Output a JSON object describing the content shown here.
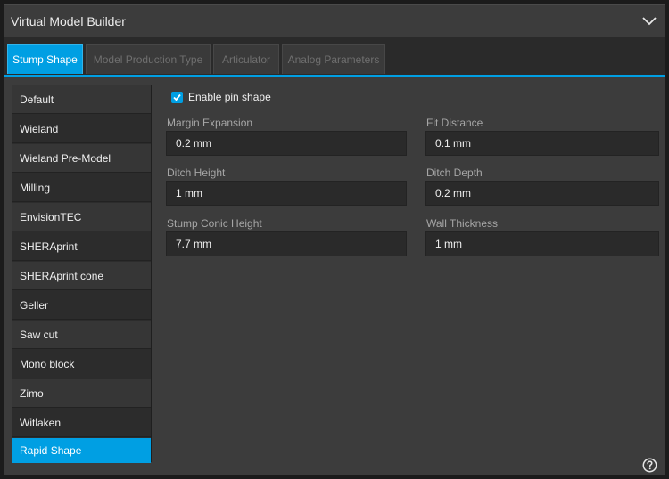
{
  "window": {
    "title": "Virtual Model Builder"
  },
  "tabs": [
    {
      "label": "Stump Shape",
      "active": true
    },
    {
      "label": "Model Production Type",
      "active": false
    },
    {
      "label": "Articulator",
      "active": false
    },
    {
      "label": "Analog Parameters",
      "active": false
    }
  ],
  "list": {
    "items": [
      {
        "label": "Default"
      },
      {
        "label": "Wieland"
      },
      {
        "label": "Wieland Pre-Model"
      },
      {
        "label": "Milling"
      },
      {
        "label": "EnvisionTEC"
      },
      {
        "label": "SHERAprint"
      },
      {
        "label": "SHERAprint cone"
      },
      {
        "label": "Geller"
      },
      {
        "label": "Saw cut"
      },
      {
        "label": "Mono block"
      },
      {
        "label": "Zimo"
      },
      {
        "label": "Witlaken"
      },
      {
        "label": "Rapid Shape"
      }
    ],
    "selected": "Rapid Shape"
  },
  "options": {
    "enable_pin_shape": {
      "label": "Enable pin shape",
      "checked": true
    }
  },
  "fields": {
    "margin_expansion": {
      "label": "Margin Expansion",
      "value": "0.2 mm"
    },
    "fit_distance": {
      "label": "Fit Distance",
      "value": "0.1 mm"
    },
    "ditch_height": {
      "label": "Ditch Height",
      "value": "1 mm"
    },
    "ditch_depth": {
      "label": "Ditch Depth",
      "value": "0.2 mm"
    },
    "stump_conic_height": {
      "label": "Stump Conic Height",
      "value": "7.7 mm"
    },
    "wall_thickness": {
      "label": "Wall Thickness",
      "value": "1 mm"
    }
  },
  "colors": {
    "accent": "#009fe3",
    "panel": "#3c3c3c",
    "input_bg": "#2a2a2a"
  },
  "icons": {
    "collapse": "chevron-down-icon",
    "checkbox": "checkmark-icon",
    "help": "question-circle-icon"
  }
}
